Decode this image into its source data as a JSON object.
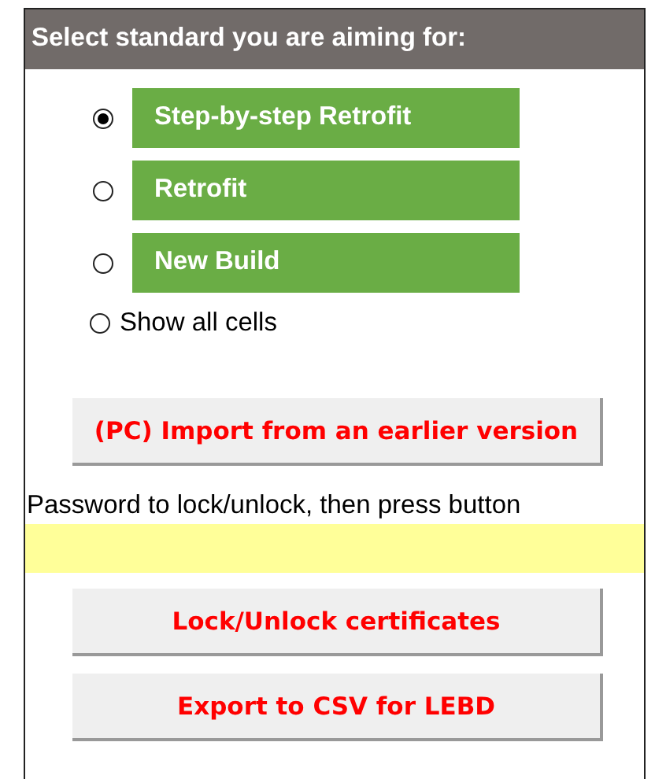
{
  "header": {
    "title": "Select standard you are aiming for:"
  },
  "options": [
    {
      "label": "Step-by-step Retrofit",
      "kind": "standard",
      "selected": true
    },
    {
      "label": "Retrofit",
      "kind": "standard",
      "selected": false
    },
    {
      "label": "New Build",
      "kind": "standard",
      "selected": false
    },
    {
      "label": "Show all cells",
      "kind": "plain",
      "selected": false
    }
  ],
  "import_button": "(PC) Import from an earlier version",
  "password": {
    "label": "Password to lock/unlock, then press button"
  },
  "buttons": [
    "Lock/Unlock certificates",
    "Export to CSV for LEBD"
  ]
}
